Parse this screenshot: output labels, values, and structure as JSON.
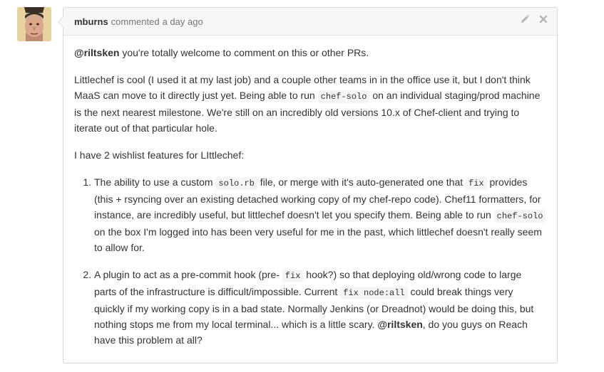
{
  "comment": {
    "author": "mburns",
    "action": "commented",
    "timestamp": "a day ago",
    "icons": {
      "edit": "pencil-icon",
      "delete": "close-icon"
    },
    "p1": {
      "mention": "@riltsken",
      "text": " you're totally welcome to comment on this or other PRs."
    },
    "p2": {
      "t1": "Littlechef is cool (I used it at my last job) and a couple other teams in in the office use it, but I don't think MaaS can move to it directly just yet. Being able to run ",
      "c1": "chef-solo",
      "t2": " on an individual staging/prod machine is the next nearest milestone. We're still on an incredibly old versions 10.x of Chef-client and trying to iterate out of that particular hole."
    },
    "p3": "I have 2 wishlist features for LIttlechef:",
    "item1": {
      "t1": "The ability to use a custom ",
      "c1": "solo.rb",
      "t2": " file, or merge with it's auto-generated one that ",
      "c2": "fix",
      "t3": " provides (this + rsyncing over an existing detached working copy of my chef-repo code). Chef11 formatters, for instance, are incredibly useful, but littlechef doesn't let you specify them. Being able to run ",
      "c3": "chef-solo",
      "t4": " on the box I'm logged into has been very useful for me in the past, which littlechef doesn't really seem to allow for."
    },
    "item2": {
      "t1": "A plugin to act as a pre-commit hook (pre- ",
      "c1": "fix",
      "t2": " hook?) so that deploying old/wrong code to large parts of the infrastructure is difficult/impossible. Current ",
      "c2": "fix node:all",
      "t3": " could break things very quickly if my working copy is in a bad state. Normally Jenkins (or Dreadnot) would be doing this, but nothing stops me from my local terminal... which is a little scary. ",
      "mention": "@riltsken",
      "t4": ", do you guys on Reach have this problem at all?"
    }
  }
}
